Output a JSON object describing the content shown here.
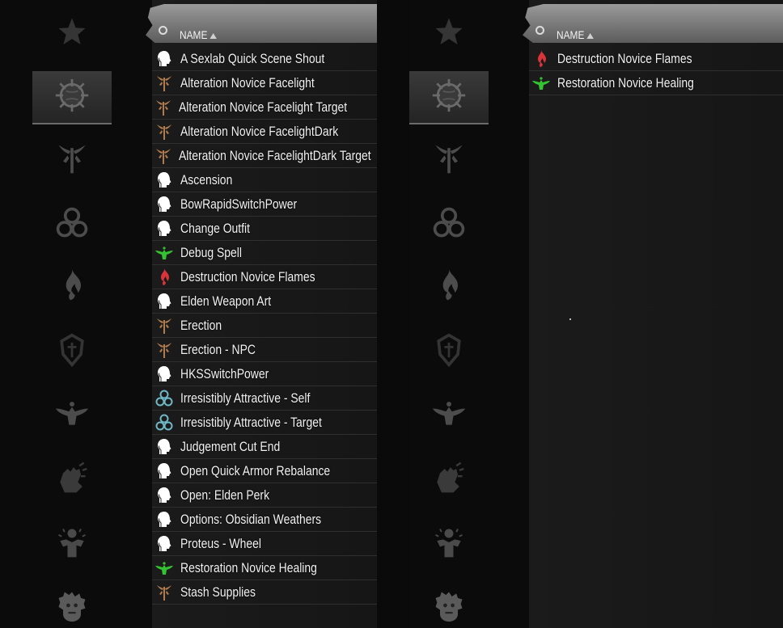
{
  "left_panel": {
    "header": {
      "label": "NAME",
      "sort": "ascending"
    },
    "categories": [
      {
        "icon": "star-icon",
        "selected": false
      },
      {
        "icon": "alteration-school-icon",
        "selected": true
      },
      {
        "icon": "alteration-totem-icon",
        "selected": false
      },
      {
        "icon": "illusion-rings-icon",
        "selected": false
      },
      {
        "icon": "destruction-fire-icon",
        "selected": false
      },
      {
        "icon": "conjuration-shield-icon",
        "selected": false
      },
      {
        "icon": "restoration-wings-icon",
        "selected": false
      },
      {
        "icon": "power-hand-icon",
        "selected": false
      },
      {
        "icon": "character-figure-icon",
        "selected": false
      },
      {
        "icon": "face-mask-icon",
        "selected": false
      }
    ],
    "items": [
      {
        "label": "A Sexlab Quick Scene Shout",
        "icon": "head-profile-icon"
      },
      {
        "label": "Alteration Novice Facelight",
        "icon": "alteration-totem-icon"
      },
      {
        "label": "Alteration Novice Facelight Target",
        "icon": "alteration-totem-icon"
      },
      {
        "label": "Alteration Novice FacelightDark",
        "icon": "alteration-totem-icon"
      },
      {
        "label": "Alteration Novice FacelightDark Target",
        "icon": "alteration-totem-icon"
      },
      {
        "label": "Ascension",
        "icon": "head-profile-icon"
      },
      {
        "label": "BowRapidSwitchPower",
        "icon": "head-profile-icon"
      },
      {
        "label": "Change Outfit",
        "icon": "head-profile-icon"
      },
      {
        "label": "Debug Spell",
        "icon": "restoration-wings-icon"
      },
      {
        "label": "Destruction Novice Flames",
        "icon": "destruction-fire-icon"
      },
      {
        "label": "Elden Weapon Art",
        "icon": "head-profile-icon"
      },
      {
        "label": "Erection",
        "icon": "alteration-totem-icon"
      },
      {
        "label": "Erection - NPC",
        "icon": "alteration-totem-icon"
      },
      {
        "label": "HKSSwitchPower",
        "icon": "head-profile-icon"
      },
      {
        "label": "Irresistibly Attractive - Self",
        "icon": "illusion-rings-icon"
      },
      {
        "label": "Irresistibly Attractive - Target",
        "icon": "illusion-rings-icon"
      },
      {
        "label": "Judgement Cut End",
        "icon": "head-profile-icon"
      },
      {
        "label": "Open Quick Armor Rebalance",
        "icon": "head-profile-icon"
      },
      {
        "label": "Open: Elden Perk",
        "icon": "head-profile-icon"
      },
      {
        "label": "Options: Obsidian Weathers",
        "icon": "head-profile-icon"
      },
      {
        "label": "Proteus - Wheel",
        "icon": "head-profile-icon"
      },
      {
        "label": "Restoration Novice Healing",
        "icon": "restoration-wings-icon"
      },
      {
        "label": "Stash Supplies",
        "icon": "alteration-totem-icon"
      }
    ]
  },
  "right_panel": {
    "header": {
      "label": "NAME",
      "sort": "ascending"
    },
    "items": [
      {
        "label": "Destruction Novice Flames",
        "icon": "destruction-fire-icon"
      },
      {
        "label": "Restoration Novice Healing",
        "icon": "restoration-wings-icon"
      }
    ]
  },
  "colors": {
    "fire": "#d8343a",
    "healing": "#35c232",
    "alteration": "#b07c4e",
    "illusion": "#6fb8c6",
    "power": "#ffffff"
  }
}
